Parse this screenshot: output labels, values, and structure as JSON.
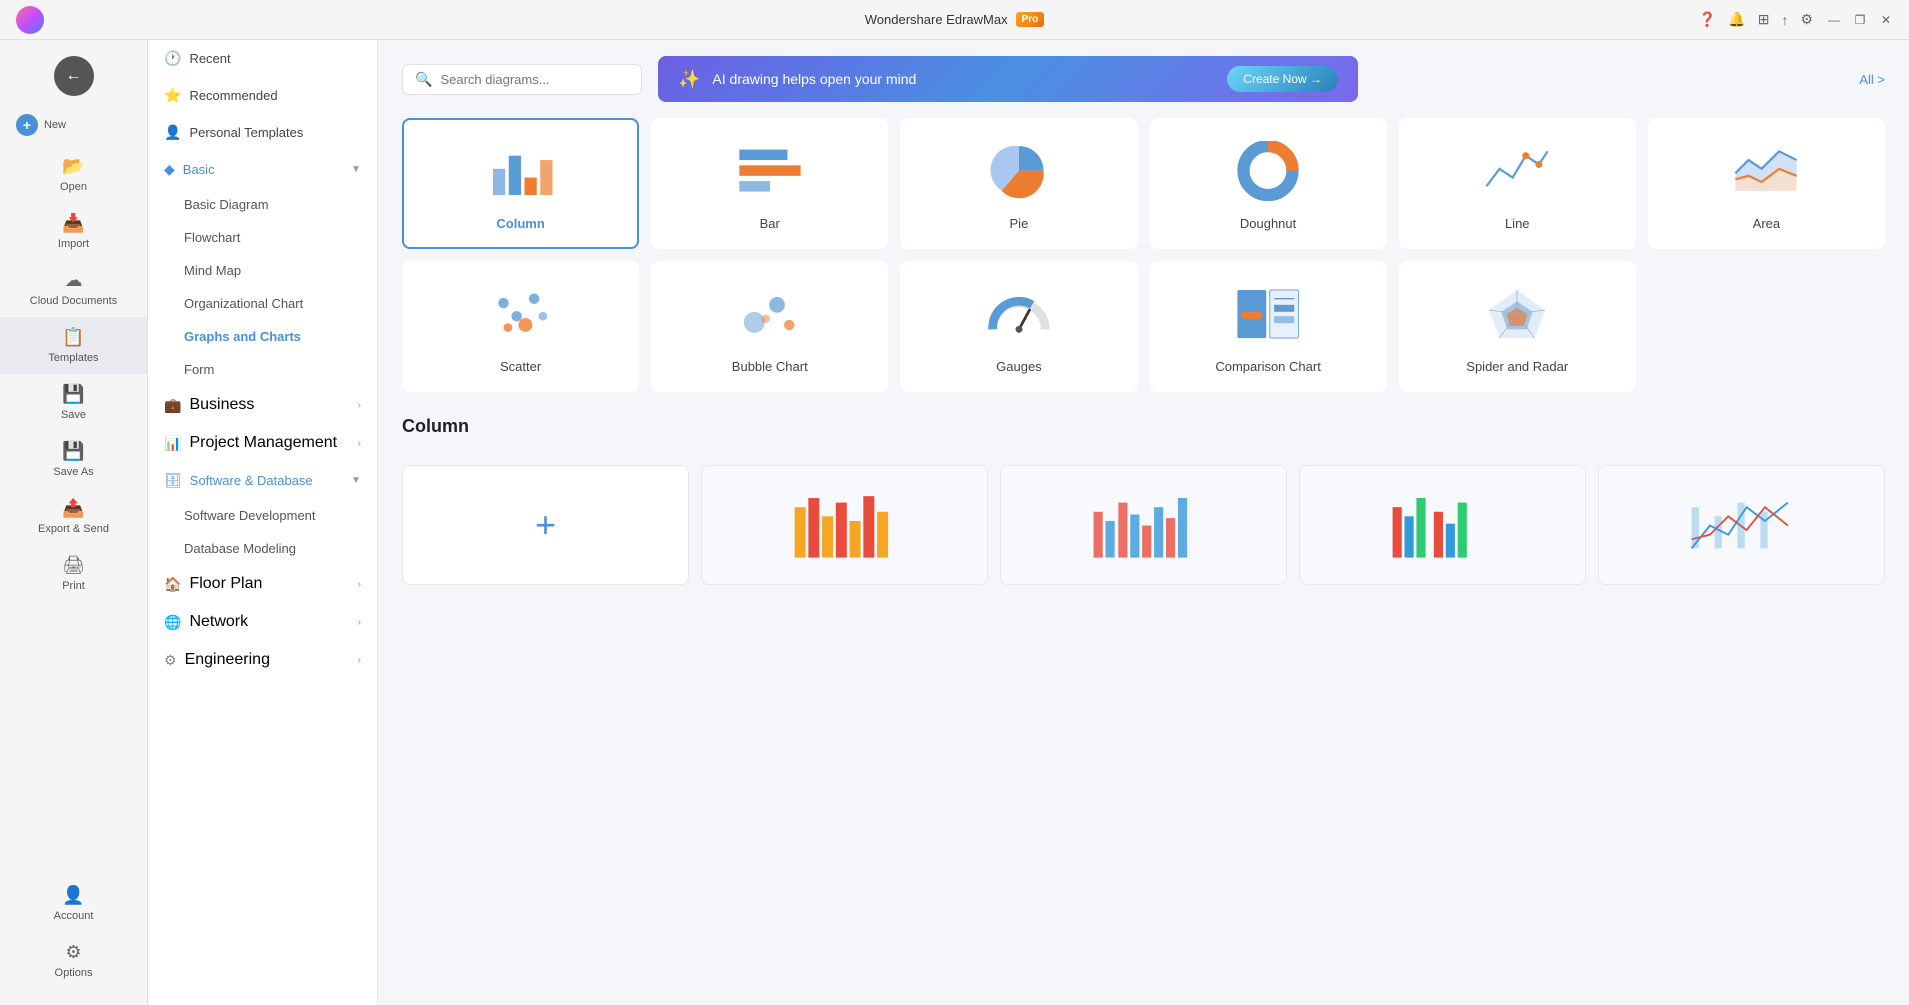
{
  "titlebar": {
    "title": "Wondershare EdrawMax",
    "pro_label": "Pro",
    "min_btn": "—",
    "max_btn": "❐",
    "close_btn": "✕"
  },
  "left_panel": {
    "items": [
      {
        "id": "new",
        "label": "New",
        "icon": "+"
      },
      {
        "id": "open",
        "label": "Open",
        "icon": "📂"
      },
      {
        "id": "import",
        "label": "Import",
        "icon": "📥"
      },
      {
        "id": "cloud",
        "label": "Cloud Documents",
        "icon": "☁"
      },
      {
        "id": "templates",
        "label": "Templates",
        "icon": "📋"
      },
      {
        "id": "save",
        "label": "Save",
        "icon": "💾"
      },
      {
        "id": "saveas",
        "label": "Save As",
        "icon": "💾"
      },
      {
        "id": "export",
        "label": "Export & Send",
        "icon": "📤"
      },
      {
        "id": "print",
        "label": "Print",
        "icon": "🖨"
      }
    ],
    "bottom_items": [
      {
        "id": "account",
        "label": "Account",
        "icon": "👤"
      },
      {
        "id": "options",
        "label": "Options",
        "icon": "⚙"
      }
    ]
  },
  "sidebar": {
    "items": [
      {
        "id": "recent",
        "label": "Recent",
        "icon": "🕐",
        "type": "item"
      },
      {
        "id": "recommended",
        "label": "Recommended",
        "icon": "⭐",
        "type": "item"
      },
      {
        "id": "personal",
        "label": "Personal Templates",
        "icon": "👤",
        "type": "item"
      },
      {
        "id": "basic",
        "label": "Basic",
        "icon": "◆",
        "type": "group",
        "expanded": true,
        "children": [
          {
            "id": "basic-diagram",
            "label": "Basic Diagram"
          },
          {
            "id": "flowchart",
            "label": "Flowchart"
          },
          {
            "id": "mind-map",
            "label": "Mind Map"
          },
          {
            "id": "org-chart",
            "label": "Organizational Chart"
          },
          {
            "id": "graphs",
            "label": "Graphs and Charts",
            "active": true
          },
          {
            "id": "form",
            "label": "Form"
          }
        ]
      },
      {
        "id": "business",
        "label": "Business",
        "icon": "💼",
        "type": "group",
        "has_arrow": true
      },
      {
        "id": "project",
        "label": "Project Management",
        "icon": "📊",
        "type": "group",
        "has_arrow": true
      },
      {
        "id": "software",
        "label": "Software & Database",
        "icon": "🗄",
        "type": "group",
        "expanded": true,
        "children": [
          {
            "id": "sw-dev",
            "label": "Software Development"
          },
          {
            "id": "db-model",
            "label": "Database Modeling"
          }
        ]
      },
      {
        "id": "floor",
        "label": "Floor Plan",
        "icon": "🏠",
        "type": "group",
        "has_arrow": true
      },
      {
        "id": "network",
        "label": "Network",
        "icon": "🌐",
        "type": "group",
        "has_arrow": true
      },
      {
        "id": "engineering",
        "label": "Engineering",
        "icon": "⚙",
        "type": "group",
        "has_arrow": true
      }
    ]
  },
  "search": {
    "placeholder": "Search diagrams..."
  },
  "ai_banner": {
    "icon": "✨",
    "text": "AI drawing helps open your mind",
    "btn_label": "Create Now →"
  },
  "all_link": "All >",
  "charts": [
    {
      "id": "column",
      "label": "Column",
      "selected": true
    },
    {
      "id": "bar",
      "label": "Bar",
      "selected": false
    },
    {
      "id": "pie",
      "label": "Pie",
      "selected": false
    },
    {
      "id": "doughnut",
      "label": "Doughnut",
      "selected": false
    },
    {
      "id": "line",
      "label": "Line",
      "selected": false
    },
    {
      "id": "area",
      "label": "Area",
      "selected": false
    },
    {
      "id": "scatter",
      "label": "Scatter",
      "selected": false
    },
    {
      "id": "bubble",
      "label": "Bubble Chart",
      "selected": false
    },
    {
      "id": "gauges",
      "label": "Gauges",
      "selected": false
    },
    {
      "id": "comparison",
      "label": "Comparison Chart",
      "selected": false
    },
    {
      "id": "spider",
      "label": "Spider and Radar",
      "selected": false
    }
  ],
  "column_section": {
    "title": "Column"
  }
}
